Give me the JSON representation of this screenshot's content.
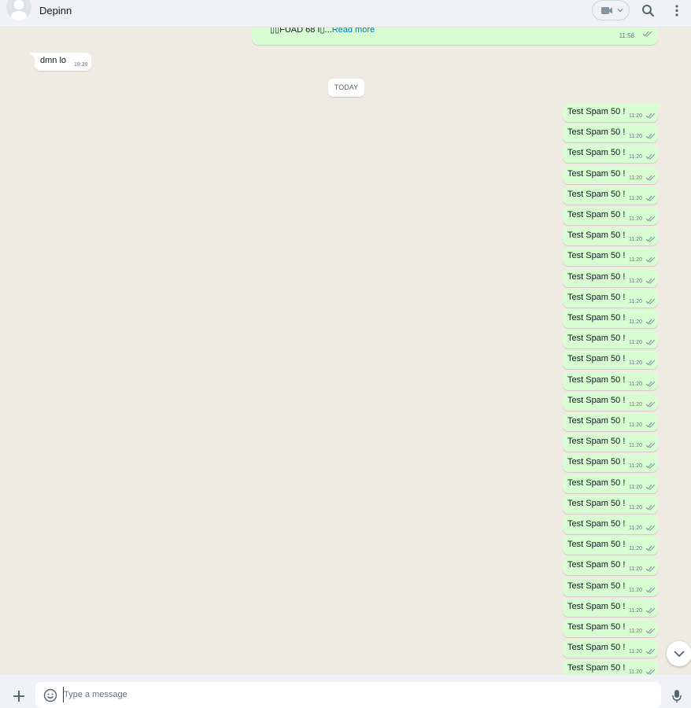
{
  "header": {
    "contact_name": "Depinn",
    "avatar_icon": "default-avatar-icon",
    "video_icon": "video-camera-icon",
    "search_icon": "search-icon",
    "menu_icon": "kebab-menu-icon"
  },
  "chat": {
    "top_message": {
      "text": "▯▯FUAD 68 I▯...",
      "read_more": "Read more",
      "time": "11:58"
    },
    "incoming_message": {
      "text": "dmn lo",
      "time": "19:39"
    },
    "date_divider": "TODAY",
    "outgoing_messages": [
      {
        "text": "Test Spam 50 !",
        "time": "11:20"
      },
      {
        "text": "Test Spam 50 !",
        "time": "11:20"
      },
      {
        "text": "Test Spam 50 !",
        "time": "11:20"
      },
      {
        "text": "Test Spam 50 !",
        "time": "11:20"
      },
      {
        "text": "Test Spam 50 !",
        "time": "11:20"
      },
      {
        "text": "Test Spam 50 !",
        "time": "11:20"
      },
      {
        "text": "Test Spam 50 !",
        "time": "11:20"
      },
      {
        "text": "Test Spam 50 !",
        "time": "11:20"
      },
      {
        "text": "Test Spam 50 !",
        "time": "11:20"
      },
      {
        "text": "Test Spam 50 !",
        "time": "11:20"
      },
      {
        "text": "Test Spam 50 !",
        "time": "11:20"
      },
      {
        "text": "Test Spam 50 !",
        "time": "11:20"
      },
      {
        "text": "Test Spam 50 !",
        "time": "11:20"
      },
      {
        "text": "Test Spam 50 !",
        "time": "11:20"
      },
      {
        "text": "Test Spam 50 !",
        "time": "11:20"
      },
      {
        "text": "Test Spam 50 !",
        "time": "11:20"
      },
      {
        "text": "Test Spam 50 !",
        "time": "11:20"
      },
      {
        "text": "Test Spam 50 !",
        "time": "11:20"
      },
      {
        "text": "Test Spam 50 !",
        "time": "11:20"
      },
      {
        "text": "Test Spam 50 !",
        "time": "11:20"
      },
      {
        "text": "Test Spam 50 !",
        "time": "11:20"
      },
      {
        "text": "Test Spam 50 !",
        "time": "11:20"
      },
      {
        "text": "Test Spam 50 !",
        "time": "11:20"
      },
      {
        "text": "Test Spam 50 !",
        "time": "11:20"
      },
      {
        "text": "Test Spam 50 !",
        "time": "11:20"
      },
      {
        "text": "Test Spam 50 !",
        "time": "11:20"
      },
      {
        "text": "Test Spam 50 !",
        "time": "11:20"
      },
      {
        "text": "Test Spam 50 !",
        "time": "11:20"
      }
    ],
    "scroll_down_icon": "chevron-down-icon"
  },
  "footer": {
    "attach_icon": "plus-icon",
    "emoji_icon": "smiley-icon",
    "placeholder": "Type a message",
    "mic_icon": "microphone-icon"
  },
  "colors": {
    "outgoing_bubble": "#d9fdd3",
    "incoming_bubble": "#ffffff",
    "chat_background": "#efeae2",
    "link": "#027eb5",
    "tick": "#8696a0"
  }
}
